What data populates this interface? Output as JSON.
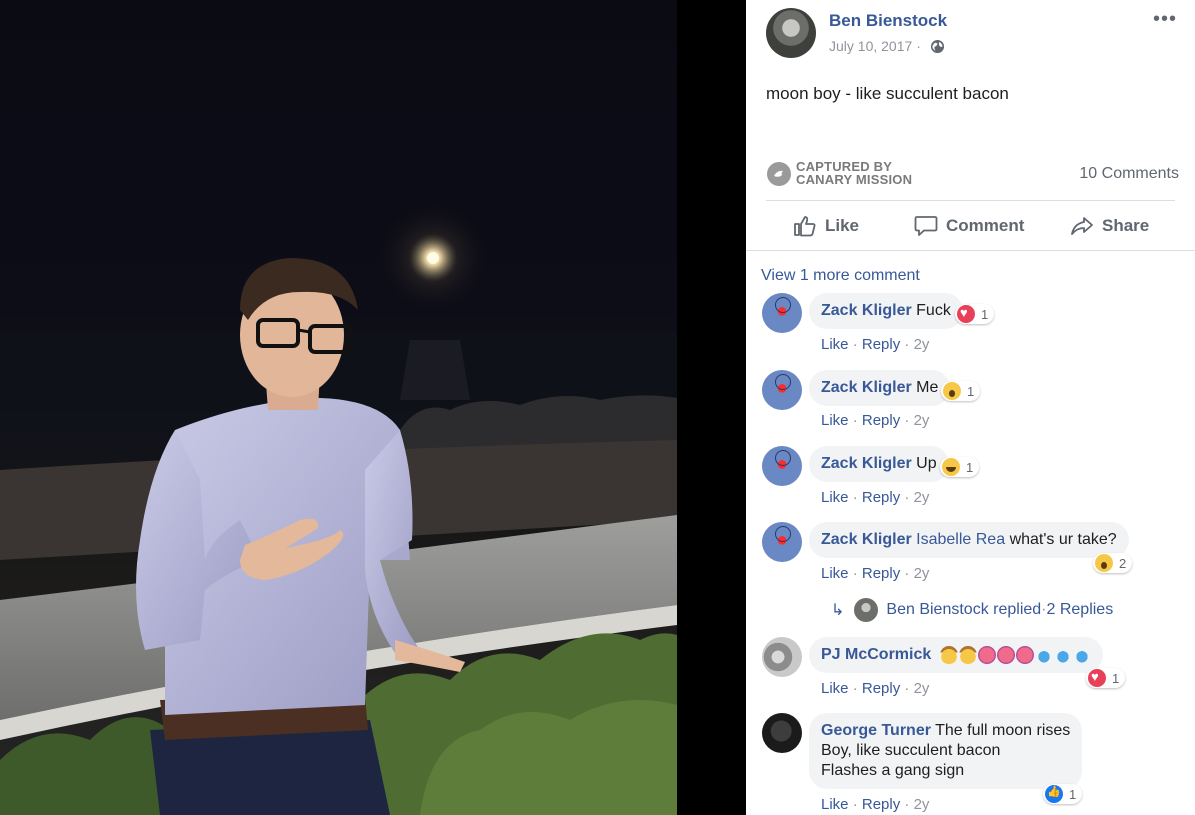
{
  "post": {
    "author": "Ben Bienstock",
    "date": "July 10, 2017",
    "date_separator": "·",
    "text": "moon boy - like succulent bacon",
    "more_label": "•••",
    "captured_line1": "CAPTURED BY",
    "captured_line2": "CANARY MISSION",
    "comment_count": "10 Comments"
  },
  "actions": {
    "like": "Like",
    "comment": "Comment",
    "share": "Share"
  },
  "comments_section": {
    "view_more": "View 1 more comment",
    "meta_like": "Like",
    "meta_reply": "Reply",
    "meta_sep": " · ",
    "meta_time": "2y",
    "reply_summary": {
      "author": "Ben Bienstock",
      "verb": "replied",
      "sep": " · ",
      "count": "2 Replies"
    },
    "comments": [
      {
        "author": "Zack Kligler",
        "text": "Fuck",
        "reaction": "love",
        "reaction_count": "1"
      },
      {
        "author": "Zack Kligler",
        "text": "Me",
        "reaction": "wow",
        "reaction_count": "1"
      },
      {
        "author": "Zack Kligler",
        "text": "Up",
        "reaction": "haha",
        "reaction_count": "1"
      },
      {
        "author": "Zack Kligler",
        "tag": "Isabelle Rea",
        "text": "what's ur take?",
        "reaction": "wow",
        "reaction_count": "2"
      },
      {
        "author": "PJ McCormick",
        "text": "",
        "emojis": [
          "cowboy",
          "cowboy",
          "tired",
          "tired",
          "tired",
          "sweat-drops",
          "sweat-drops",
          "sweat-drops"
        ],
        "reaction": "love",
        "reaction_count": "1"
      },
      {
        "author": "George Turner",
        "text_lines": [
          "The full moon rises",
          "Boy, like succulent bacon",
          "Flashes a gang sign"
        ],
        "reaction": "like",
        "reaction_count": "1"
      }
    ]
  },
  "colors": {
    "link": "#385898",
    "meta": "#90949c",
    "bubble": "#f2f3f5"
  }
}
